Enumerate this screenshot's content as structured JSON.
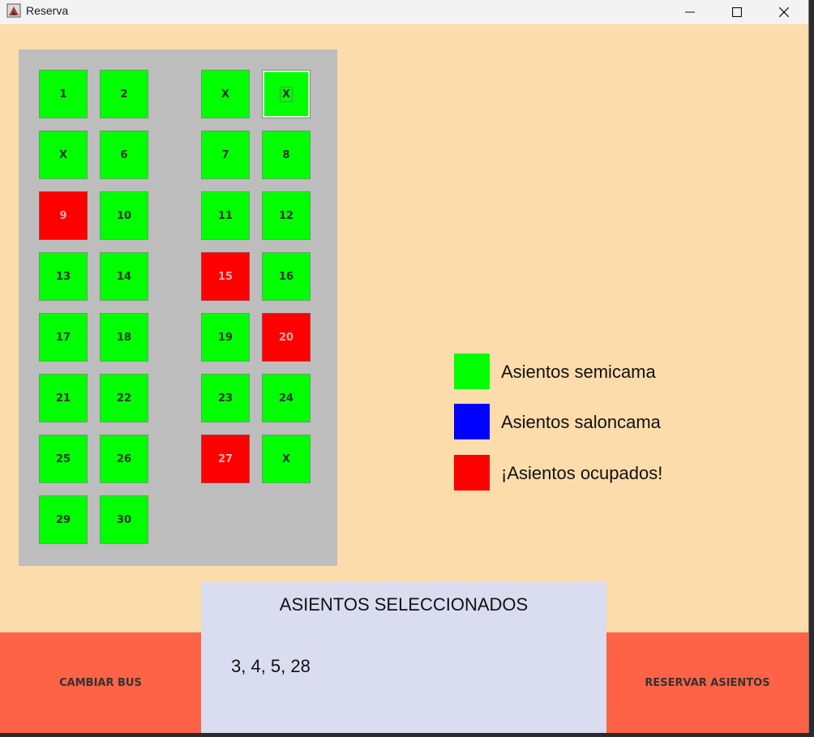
{
  "window": {
    "title": "Reserva",
    "icon": "java-app-icon"
  },
  "seats": [
    {
      "label": "1",
      "status": "free"
    },
    {
      "label": "2",
      "status": "free"
    },
    {
      "label": "X",
      "status": "free"
    },
    {
      "label": "X",
      "status": "free",
      "focused": true
    },
    {
      "label": "X",
      "status": "free"
    },
    {
      "label": "6",
      "status": "free"
    },
    {
      "label": "7",
      "status": "free"
    },
    {
      "label": "8",
      "status": "free"
    },
    {
      "label": "9",
      "status": "busy"
    },
    {
      "label": "10",
      "status": "free"
    },
    {
      "label": "11",
      "status": "free"
    },
    {
      "label": "12",
      "status": "free"
    },
    {
      "label": "13",
      "status": "free"
    },
    {
      "label": "14",
      "status": "free"
    },
    {
      "label": "15",
      "status": "busy"
    },
    {
      "label": "16",
      "status": "free"
    },
    {
      "label": "17",
      "status": "free"
    },
    {
      "label": "18",
      "status": "free"
    },
    {
      "label": "19",
      "status": "free"
    },
    {
      "label": "20",
      "status": "busy"
    },
    {
      "label": "21",
      "status": "free"
    },
    {
      "label": "22",
      "status": "free"
    },
    {
      "label": "23",
      "status": "free"
    },
    {
      "label": "24",
      "status": "free"
    },
    {
      "label": "25",
      "status": "free"
    },
    {
      "label": "26",
      "status": "free"
    },
    {
      "label": "27",
      "status": "busy"
    },
    {
      "label": "X",
      "status": "free"
    },
    {
      "label": "29",
      "status": "free"
    },
    {
      "label": "30",
      "status": "free"
    }
  ],
  "legend": [
    {
      "label": "Asientos semicama",
      "color": "#00ff00"
    },
    {
      "label": "Asientos saloncama",
      "color": "#0000ff"
    },
    {
      "label": "¡Asientos ocupados!",
      "color": "#ff0000"
    }
  ],
  "selected": {
    "title": "ASIENTOS SELECCIONADOS",
    "value": "3, 4, 5, 28"
  },
  "buttons": {
    "change_bus": "CAMBIAR BUS",
    "reserve": "RESERVAR ASIENTOS"
  },
  "colors": {
    "background": "#fcdcaa",
    "seat_free": "#00ff00",
    "seat_busy": "#ff0000",
    "button": "#ff6347",
    "selected_panel": "#dadcf0"
  }
}
